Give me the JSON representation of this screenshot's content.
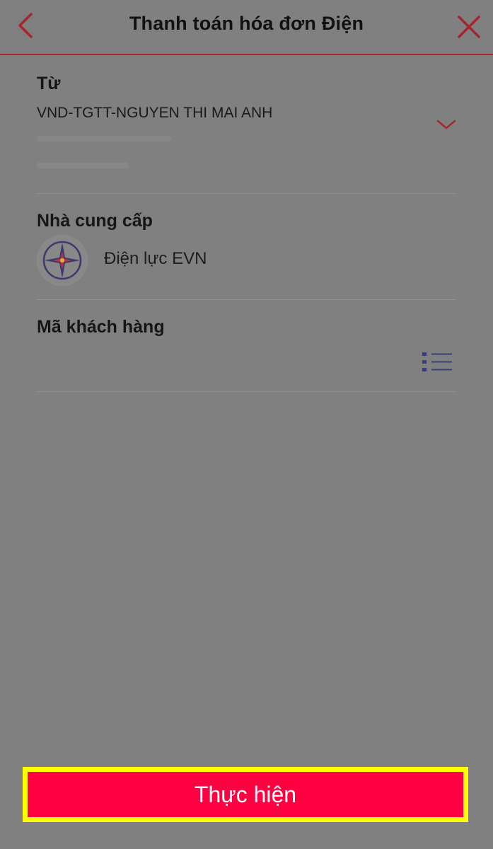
{
  "header": {
    "title": "Thanh toán hóa đơn Điện",
    "back_icon": "chevron-left-icon",
    "close_icon": "close-icon",
    "accent_color": "#b0242c"
  },
  "from": {
    "label": "Từ",
    "account": "VND-TGTT-NGUYEN THI MAI ANH",
    "dropdown_icon": "chevron-down-icon"
  },
  "provider": {
    "label": "Nhà cung cấp",
    "name": "Điện lực EVN",
    "logo_icon": "evn-logo-icon"
  },
  "customer": {
    "label": "Mã khách hàng",
    "value": "",
    "list_icon": "list-icon"
  },
  "submit": {
    "label": "Thực hiện",
    "color": "#ff0040",
    "highlight_color": "#ffff00"
  },
  "background_color": "#808080"
}
